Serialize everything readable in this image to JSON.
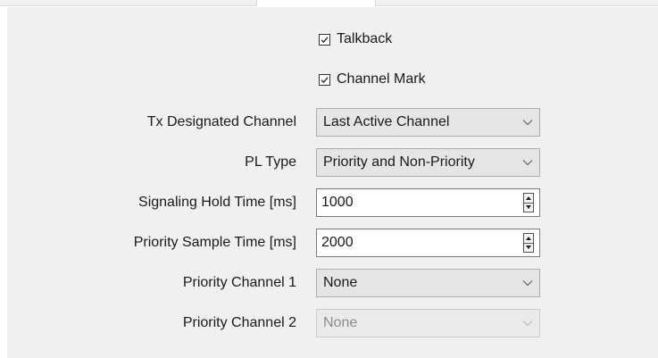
{
  "checkboxes": {
    "talkback": {
      "label": "Talkback",
      "checked": true
    },
    "channel_mark": {
      "label": "Channel Mark",
      "checked": true
    }
  },
  "fields": {
    "tx_designated_channel": {
      "label": "Tx Designated Channel",
      "value": "Last Active Channel",
      "enabled": true
    },
    "pl_type": {
      "label": "PL Type",
      "value": "Priority and Non-Priority",
      "enabled": true
    },
    "signaling_hold_time": {
      "label": "Signaling Hold Time [ms]",
      "value": "1000"
    },
    "priority_sample_time": {
      "label": "Priority Sample Time [ms]",
      "value": "2000"
    },
    "priority_channel_1": {
      "label": "Priority Channel 1",
      "value": "None",
      "enabled": true
    },
    "priority_channel_2": {
      "label": "Priority Channel 2",
      "value": "None",
      "enabled": false
    }
  },
  "icons": {
    "checkbox": "check-icon",
    "dropdown": "chevron-down-icon",
    "spin_up": "triangle-up-icon",
    "spin_down": "triangle-down-icon"
  },
  "colors": {
    "panel_background": "#f0f0f0",
    "combo_background": "#e5e5e5",
    "disabled_text": "#8c8c8c"
  }
}
